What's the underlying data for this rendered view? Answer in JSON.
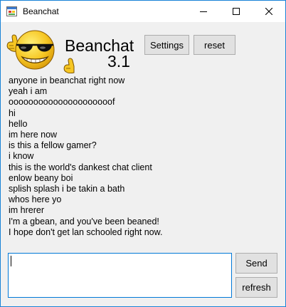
{
  "window": {
    "title": "Beanchat",
    "icon": "winforms-app-icon",
    "border_color": "#1883d7"
  },
  "titlebar_buttons": [
    "minimize-icon",
    "maximize-icon",
    "close-icon"
  ],
  "brand": {
    "name": "Beanchat",
    "version": "3.1",
    "logo": "sunglasses-thumbs-up-emoji"
  },
  "toolbar": {
    "settings_label": "Settings",
    "reset_label": "reset"
  },
  "messages": [
    "anyone in beanchat right now",
    "yeah i am",
    "ooooooooooooooooooooof",
    "hi",
    "hello",
    "im here now",
    "is this a fellow gamer?",
    "i know",
    "this is the world's dankest chat client",
    "enlow beany boi",
    "splish splash i be takin a bath",
    "whos here yo",
    "im hrerer",
    "I'm a gbean, and you've been beaned!",
    "I hope don't get lan schooled right now."
  ],
  "compose": {
    "value": "",
    "focus_color": "#0078d7"
  },
  "actions": {
    "send_label": "Send",
    "refresh_label": "refresh"
  }
}
